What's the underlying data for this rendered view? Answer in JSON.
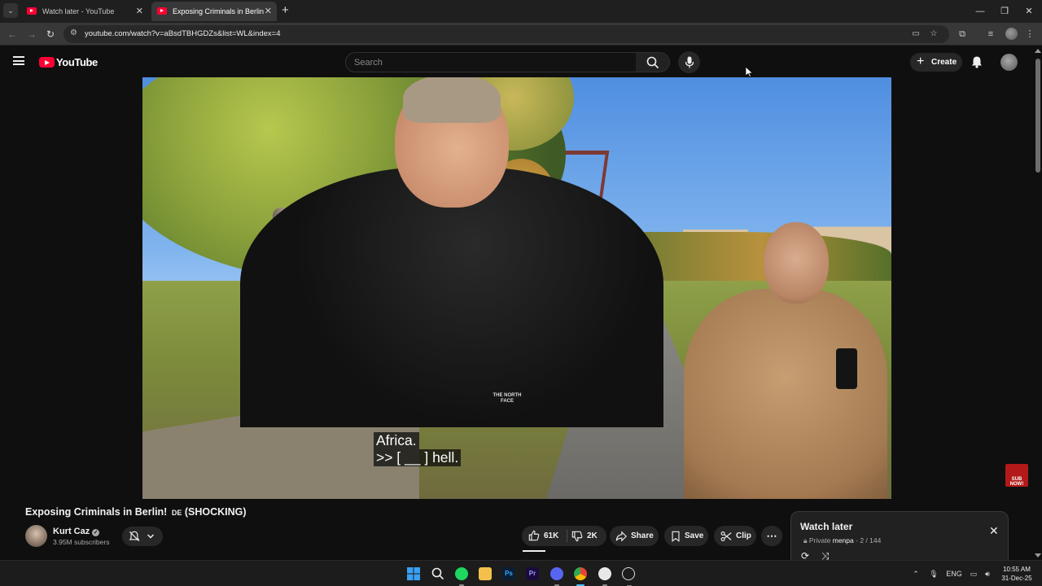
{
  "browser": {
    "tabs": [
      {
        "label": "Watch later - YouTube"
      },
      {
        "label": "Exposing Criminals in Berlin! DE (SHOCKING) - YouTube"
      }
    ],
    "url": "youtube.com/watch?v=aBsdTBHGDZs&list=WL&index=4"
  },
  "masthead": {
    "logo_text": "YouTube",
    "search_placeholder": "Search",
    "create_label": "Create"
  },
  "video": {
    "caption_line1": "Africa.",
    "caption_line2": ">> [ __ ] hell.",
    "watermark_text": "SUB NOW!",
    "shirt_logo": "THE NORTH FACE"
  },
  "details": {
    "title": "Exposing Criminals in Berlin!",
    "title_flag": "DE",
    "title_suffix": "(SHOCKING)",
    "channel_name": "Kurt Caz",
    "subscribers": "3.95M subscribers",
    "likes": "61K",
    "dislikes": "2K",
    "share_label": "Share",
    "save_label": "Save",
    "clip_label": "Clip"
  },
  "playlist": {
    "title": "Watch later",
    "privacy": "Private",
    "owner": "menpa",
    "position": "2 / 144"
  },
  "taskbar": {
    "language": "ENG",
    "time": "10:55 AM",
    "date": "31-Dec-25"
  }
}
